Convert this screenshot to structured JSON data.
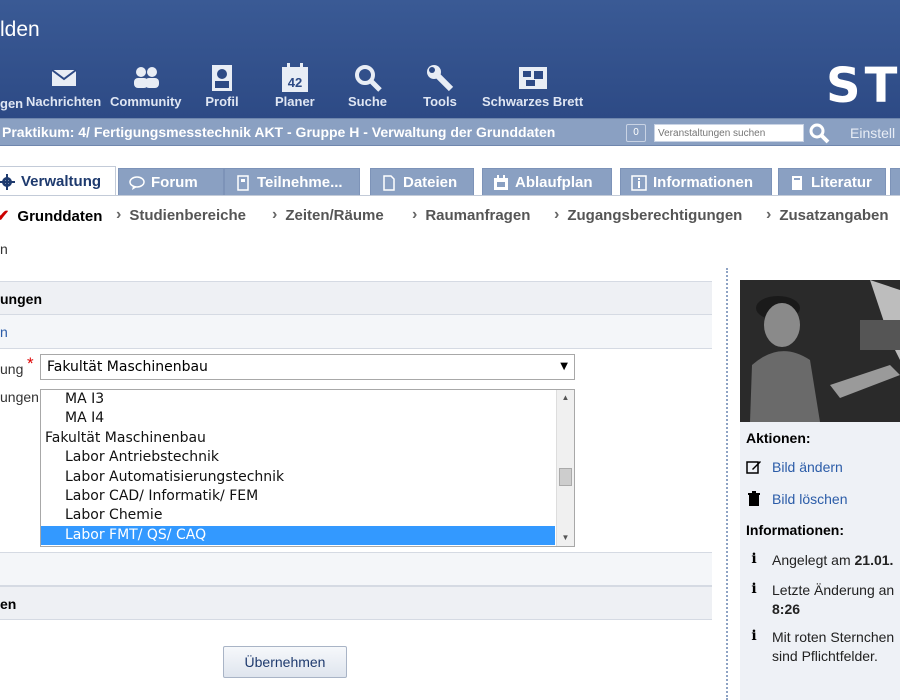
{
  "header": {
    "title_partial": "lden",
    "nav_partial_label": "gen",
    "nav": [
      {
        "label": "Nachrichten",
        "icon": "mail-icon"
      },
      {
        "label": "Community",
        "icon": "community-icon"
      },
      {
        "label": "Profil",
        "icon": "profile-icon"
      },
      {
        "label": "Planer",
        "icon": "calendar-icon",
        "badge": "42"
      },
      {
        "label": "Suche",
        "icon": "search-icon"
      },
      {
        "label": "Tools",
        "icon": "wrench-icon"
      },
      {
        "label": "Schwarzes Brett",
        "icon": "bulletin-board-icon"
      }
    ],
    "logo_text": "ST"
  },
  "context_bar": {
    "title": "Praktikum: 4/ Fertigungsmesstechnik AKT - Gruppe H - Verwaltung der Grunddaten",
    "count": "0",
    "search_placeholder": "Veranstaltungen suchen",
    "settings_partial": "Einstell"
  },
  "tabs": [
    {
      "label": "Verwaltung",
      "icon": "gear-icon",
      "active": true
    },
    {
      "label": "Forum",
      "icon": "speech-bubble-icon"
    },
    {
      "label": "Teilnehme...",
      "icon": "participants-icon"
    },
    {
      "label": "Dateien",
      "icon": "files-icon"
    },
    {
      "label": "Ablaufplan",
      "icon": "schedule-icon"
    },
    {
      "label": "Informationen",
      "icon": "info-icon"
    },
    {
      "label": "Literatur",
      "icon": "book-icon"
    }
  ],
  "subnav": [
    {
      "label": "Grunddaten",
      "active": true
    },
    {
      "label": "Studienbereiche"
    },
    {
      "label": "Zeiten/Räume"
    },
    {
      "label": "Raumanfragen"
    },
    {
      "label": "Zugangsberechtigungen"
    },
    {
      "label": "Zusatzangaben"
    }
  ],
  "partial_left": "n",
  "form": {
    "section1_partial": "ungen",
    "subsection_partial": "n",
    "field1_label_partial": "ung",
    "faculty_value": "Fakultät Maschinenbau",
    "field2_label_partial": "ungen",
    "list_items": [
      {
        "label": "MA I3",
        "level": 1
      },
      {
        "label": "MA I4",
        "level": 1
      },
      {
        "label": "Fakultät Maschinenbau",
        "level": 0
      },
      {
        "label": "Labor Antriebstechnik",
        "level": 1
      },
      {
        "label": "Labor Automatisierungstechnik",
        "level": 1
      },
      {
        "label": "Labor CAD/ Informatik/ FEM",
        "level": 1
      },
      {
        "label": "Labor Chemie",
        "level": 1
      },
      {
        "label": "Labor FMT/ QS/ CAQ",
        "level": 1,
        "selected": true
      }
    ],
    "section3_partial": "en",
    "apply_label": "Übernehmen"
  },
  "sidebar": {
    "actions_heading": "Aktionen:",
    "change_image": "Bild ändern",
    "delete_image": "Bild löschen",
    "info_heading": "Informationen:",
    "created_prefix": "Angelegt am ",
    "created_value": "21.01.",
    "modified_prefix": "Letzte Änderung an",
    "modified_time": "8:26",
    "required_note": "Mit roten Sternchen sind Pflichtfelder."
  }
}
